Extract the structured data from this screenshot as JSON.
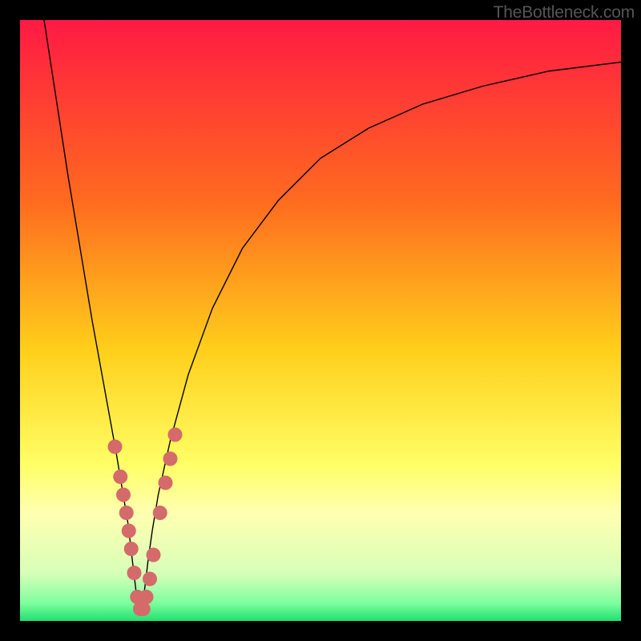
{
  "watermark": "TheBottleneck.com",
  "chart_data": {
    "type": "line",
    "title": "",
    "xlabel": "",
    "ylabel": "",
    "xlim": [
      0,
      100
    ],
    "ylim": [
      0,
      100
    ],
    "grid": false,
    "legend": false,
    "background_gradient": {
      "stops": [
        {
          "offset": 0.0,
          "color": "#ff1a44"
        },
        {
          "offset": 0.3,
          "color": "#ff6a1f"
        },
        {
          "offset": 0.55,
          "color": "#ffcf1a"
        },
        {
          "offset": 0.74,
          "color": "#ffff66"
        },
        {
          "offset": 0.82,
          "color": "#ffffb0"
        },
        {
          "offset": 0.92,
          "color": "#d8ffb8"
        },
        {
          "offset": 0.97,
          "color": "#7fff9f"
        },
        {
          "offset": 1.0,
          "color": "#20e070"
        }
      ]
    },
    "series": [
      {
        "name": "bottleneck-curve",
        "color": "#000000",
        "width": 1.4,
        "x": [
          4,
          6,
          8,
          10,
          12,
          14,
          16,
          17,
          18,
          18.7,
          19.3,
          19.8,
          20.2,
          20.7,
          21.3,
          22,
          23,
          25,
          28,
          32,
          37,
          43,
          50,
          58,
          67,
          77,
          88,
          100
        ],
        "y": [
          100,
          87,
          74,
          62,
          50,
          39,
          28,
          22,
          16,
          10,
          5,
          2,
          2,
          5,
          10,
          15,
          21,
          30,
          41,
          52,
          62,
          70,
          77,
          82,
          86,
          89,
          91.5,
          93
        ]
      }
    ],
    "markers": {
      "name": "highlight-points",
      "color": "#d46a6a",
      "radius": 9,
      "x": [
        15.8,
        16.7,
        17.2,
        17.7,
        18.1,
        18.5,
        19.0,
        19.5,
        20.0,
        20.5,
        21.0,
        21.6,
        22.2,
        23.3,
        24.2,
        25.0,
        25.8
      ],
      "y": [
        29,
        24,
        21,
        18,
        15,
        12,
        8,
        4,
        2,
        2,
        4,
        7,
        11,
        18,
        23,
        27,
        31
      ]
    }
  }
}
